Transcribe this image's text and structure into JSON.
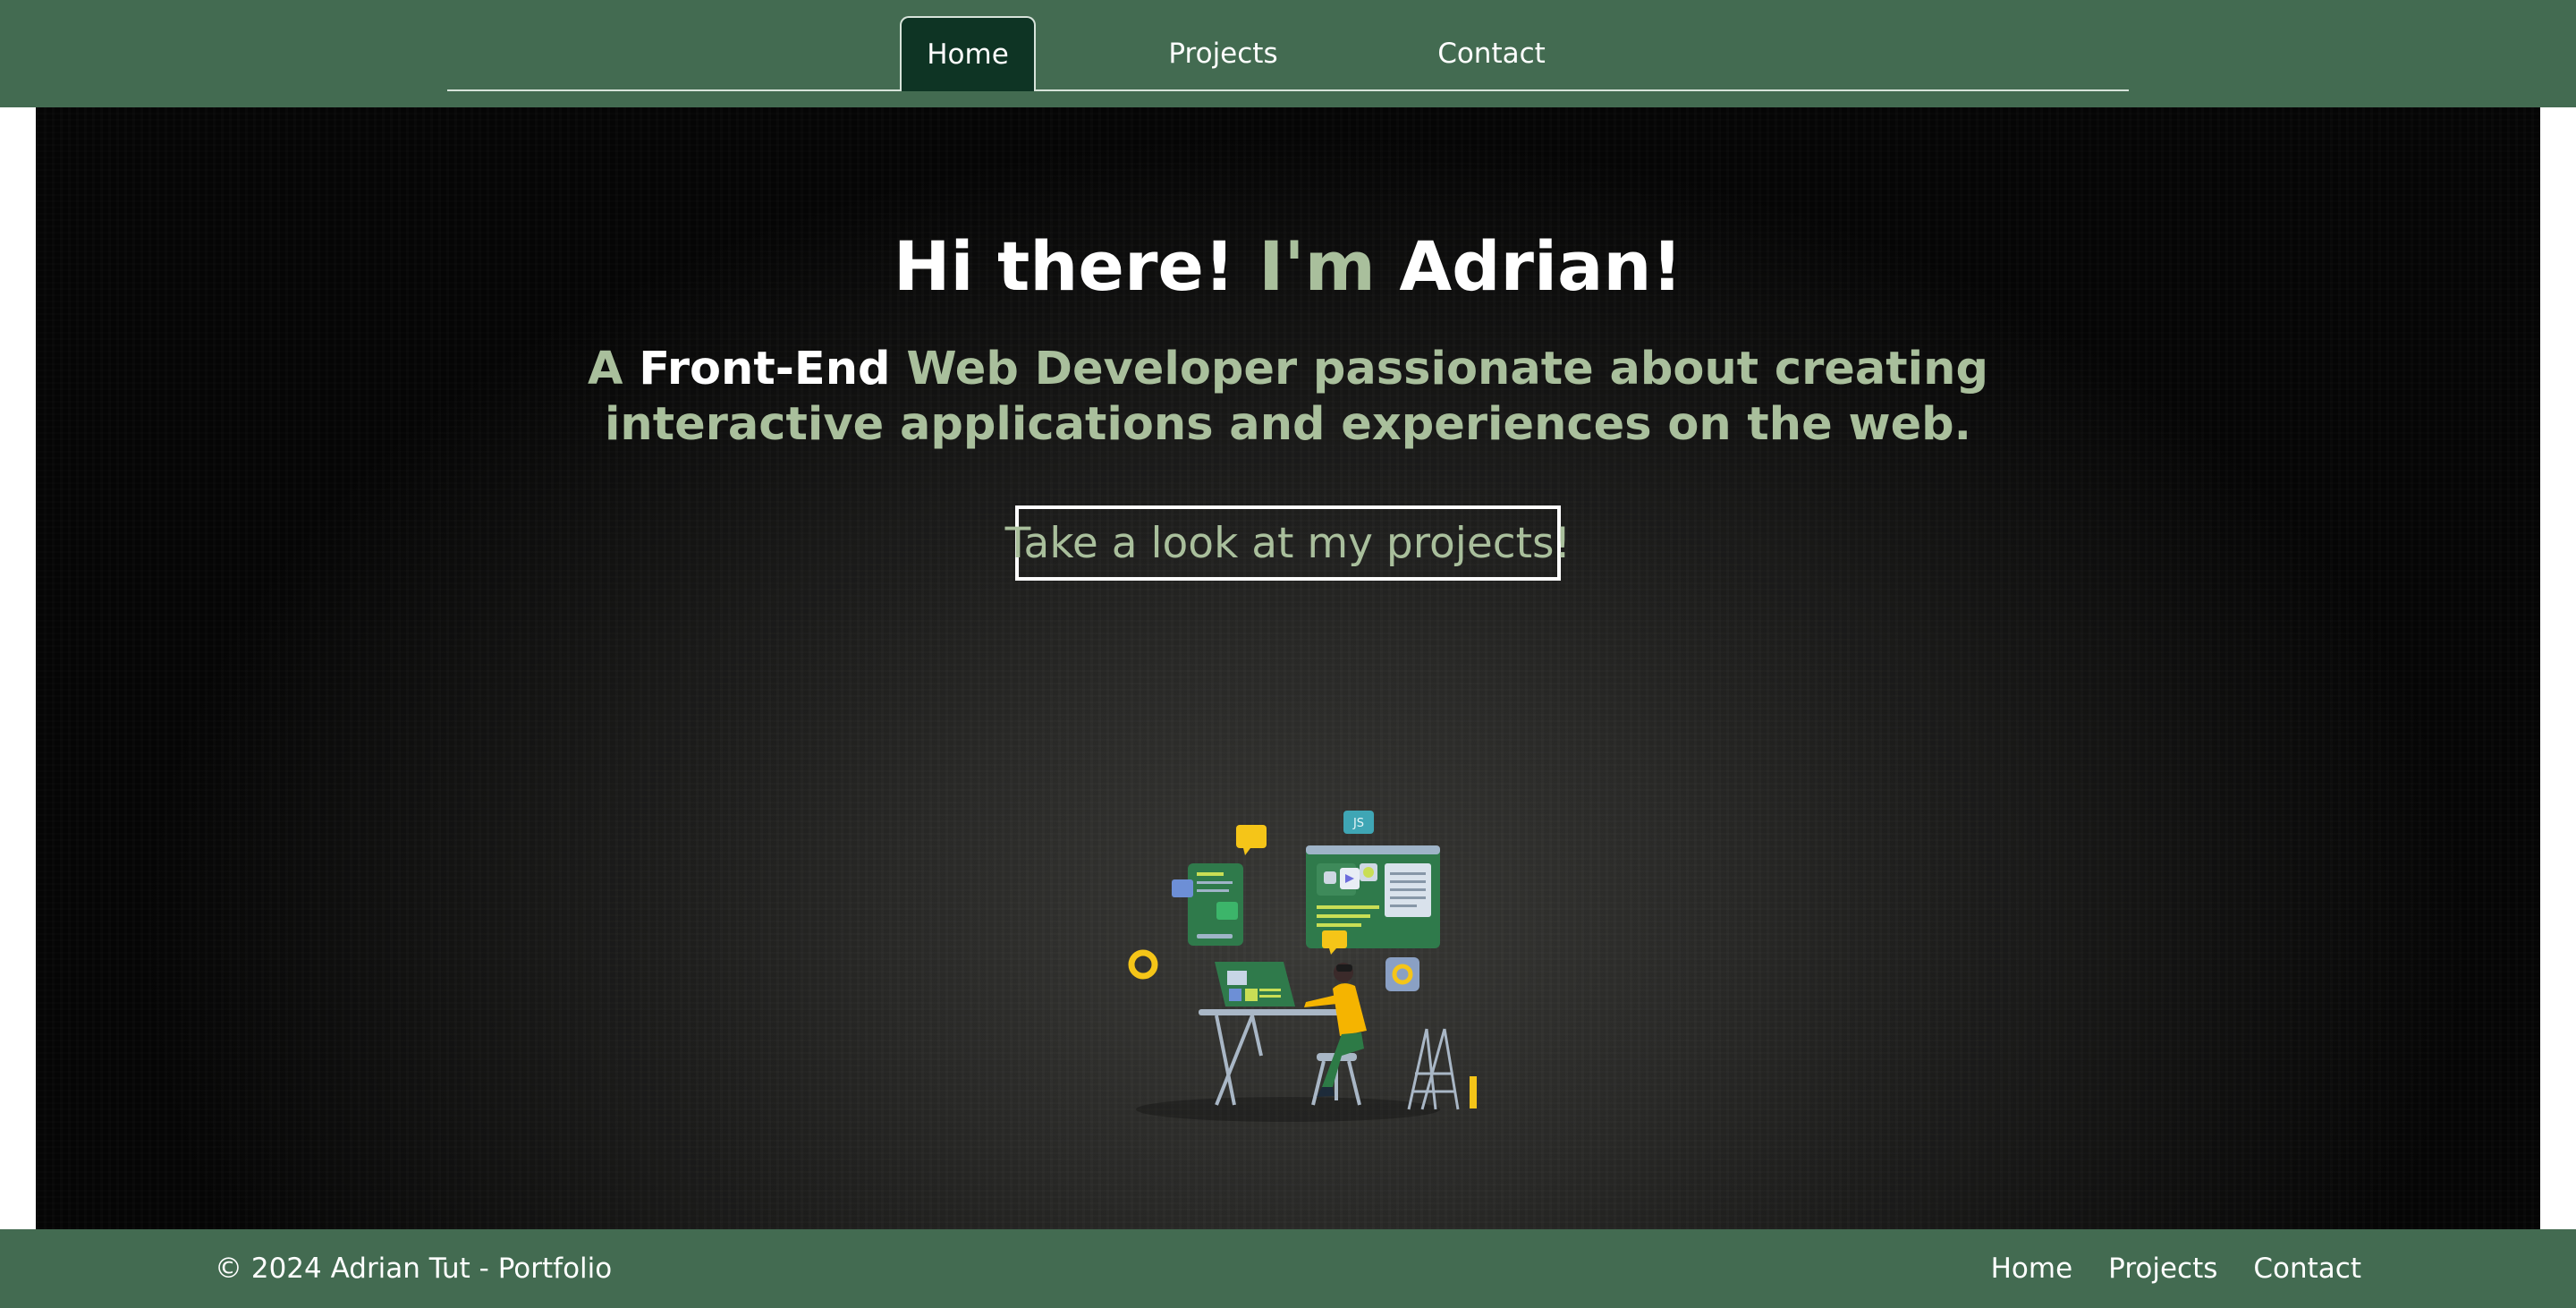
{
  "nav": {
    "tabs": [
      {
        "label": "Home",
        "active": true
      },
      {
        "label": "Projects",
        "active": false
      },
      {
        "label": "Contact",
        "active": false
      }
    ]
  },
  "hero": {
    "title_part1": "Hi there! ",
    "title_accent": "I'm",
    "title_part2": " Adrian!",
    "subtitle_prefix": "A ",
    "subtitle_strong": "Front-End",
    "subtitle_rest": " Web Developer passionate about creating interactive applications and experiences on the web.",
    "cta_label": "Take a look at my projects!",
    "illustration_badge": "JS"
  },
  "footer": {
    "copyright": "© 2024 Adrian Tut - Portfolio",
    "links": [
      {
        "label": "Home"
      },
      {
        "label": "Projects"
      },
      {
        "label": "Contact"
      }
    ]
  },
  "colors": {
    "brand_green": "#436b51",
    "active_tab": "#0e3424",
    "accent_text": "#a9bf9c",
    "illustration_yellow": "#f5c518"
  }
}
